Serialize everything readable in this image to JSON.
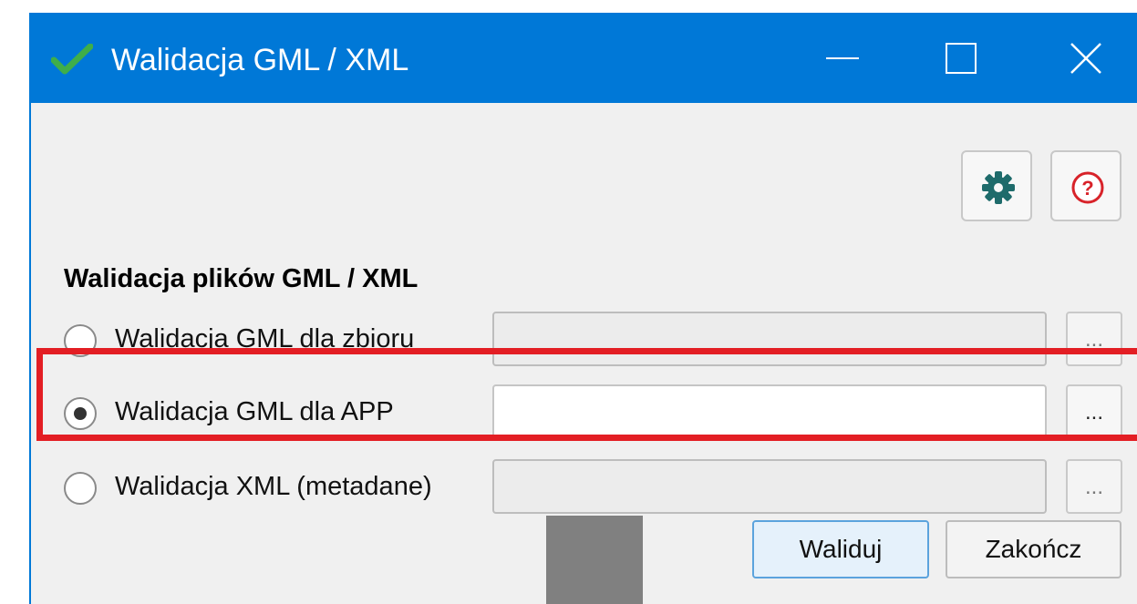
{
  "window": {
    "title": "Walidacja GML / XML",
    "icon": "check-icon",
    "accent_color": "#0078d7"
  },
  "toolbar": {
    "settings_icon": "gear-icon",
    "help_icon": "help-icon",
    "help_symbol": "?"
  },
  "section": {
    "title": "Walidacja plików GML / XML"
  },
  "options": [
    {
      "label": "Walidacja GML dla zbioru",
      "checked": false,
      "path_value": "",
      "browse_label": "..."
    },
    {
      "label": "Walidacja GML dla APP",
      "checked": true,
      "path_value": "",
      "browse_label": "..."
    },
    {
      "label": "Walidacja XML (metadane)",
      "checked": false,
      "path_value": "",
      "browse_label": "..."
    }
  ],
  "buttons": {
    "validate": "Waliduj",
    "close": "Zakończ"
  },
  "highlight_color": "#e31e24"
}
